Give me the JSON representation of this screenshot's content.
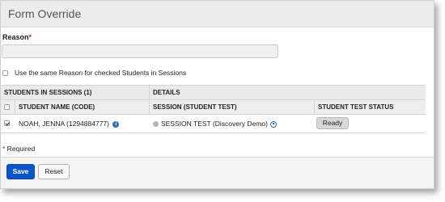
{
  "window": {
    "title": "Form Override"
  },
  "reason": {
    "label": "Reason",
    "required_marker": "*",
    "input_value": "",
    "placeholder": ""
  },
  "same_reason": {
    "label": "Use the same Reason for checked Students in Sessions",
    "checked": false
  },
  "table": {
    "group_headers": [
      "STUDENTS IN SESSIONS (1)",
      "DETAILS"
    ],
    "columns": [
      "STUDENT NAME (CODE)",
      "SESSION (STUDENT TEST)",
      "STUDENT TEST STATUS"
    ],
    "rows": [
      {
        "checked": true,
        "student": "NOAH, JENNA (1294884777)",
        "session": "SESSION TEST (Discovery Demo)",
        "status": "Ready"
      }
    ]
  },
  "required_note": {
    "marker": "*",
    "text": " Required"
  },
  "footer": {
    "save_label": "Save",
    "reset_label": "Reset"
  },
  "colors": {
    "accent": "#0b55c8",
    "required": "#c0282e",
    "info_icon": "#2a6ebb",
    "header_bg": "#ececec"
  },
  "icons": {
    "info": "info-icon",
    "session_status": "gray-dot-icon",
    "session_time": "clock-icon"
  }
}
